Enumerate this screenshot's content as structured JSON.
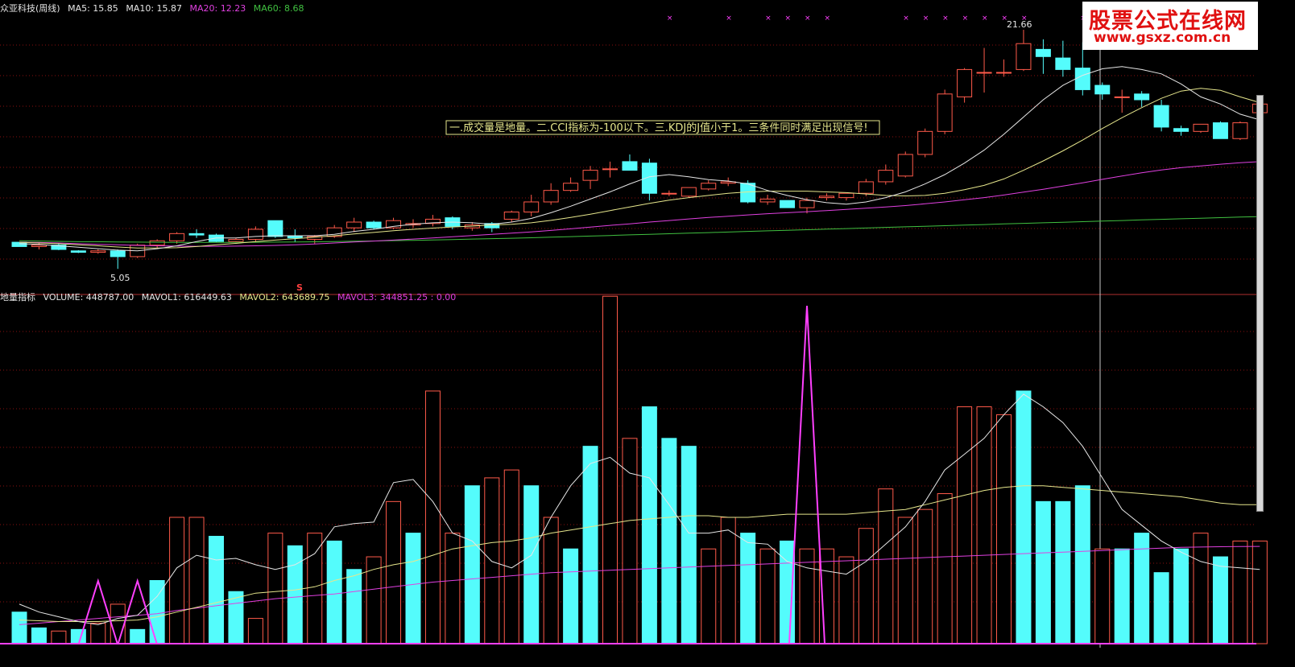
{
  "main_header": {
    "title": "众亚科技(周线)",
    "ma5": "MA5: 15.85",
    "ma10": "MA10: 15.87",
    "ma20": "MA20: 12.23",
    "ma60": "MA60: 8.68"
  },
  "volume_header": {
    "indicator_name": "地量指标",
    "volume": "VOLUME: 448787.00",
    "mavol1": "MAVOL1: 616449.63",
    "mavol2": "MAVOL2: 643689.75",
    "mavol3": "MAVOL3: 344851.25 : 0.00"
  },
  "annotation": "一.成交量是地量。二.CCI指标为-100以下。三.KDJ的J值小于1。三条件同时满足出现信号!",
  "high_label": "21.66",
  "low_label": "5.05",
  "signal_marker": "S",
  "watermark": {
    "title": "股票公式在线网",
    "url": "www.gsxz.com.cn"
  },
  "colors": {
    "up": "#ff5a4a",
    "down": "#54fcfc",
    "ma5": "#e6e6e6",
    "ma10": "#e6e68c",
    "ma20": "#e040e0",
    "ma60": "#40c040",
    "signal": "#ff40ff",
    "grid": "#8a1010"
  },
  "chart_data": [
    {
      "type": "candlestick",
      "title": "众亚科技(周线)",
      "ylim": [
        4.5,
        22.5
      ],
      "candles": [
        [
          6.9,
          6.9,
          6.6,
          6.6
        ],
        [
          6.6,
          6.85,
          6.4,
          6.7
        ],
        [
          6.7,
          6.8,
          6.35,
          6.4
        ],
        [
          6.3,
          6.35,
          6.15,
          6.2
        ],
        [
          6.2,
          6.4,
          6.1,
          6.3
        ],
        [
          6.3,
          6.4,
          5.05,
          5.9
        ],
        [
          5.9,
          6.8,
          5.8,
          6.7
        ],
        [
          6.7,
          7.1,
          6.5,
          7.0
        ],
        [
          7.0,
          7.6,
          6.8,
          7.5
        ],
        [
          7.5,
          7.8,
          7.2,
          7.4
        ],
        [
          7.4,
          7.5,
          6.9,
          6.95
        ],
        [
          6.95,
          7.2,
          6.9,
          7.1
        ],
        [
          7.1,
          8.0,
          6.9,
          7.8
        ],
        [
          8.4,
          8.4,
          7.2,
          7.3
        ],
        [
          7.3,
          7.8,
          6.9,
          7.2
        ],
        [
          7.1,
          7.4,
          6.8,
          7.3
        ],
        [
          7.3,
          8.1,
          7.2,
          7.9
        ],
        [
          7.9,
          8.6,
          7.6,
          8.3
        ],
        [
          8.3,
          8.4,
          7.8,
          7.9
        ],
        [
          7.9,
          8.6,
          7.8,
          8.4
        ],
        [
          8.1,
          8.5,
          7.9,
          8.2
        ],
        [
          8.2,
          8.8,
          8.0,
          8.5
        ],
        [
          8.6,
          8.7,
          7.8,
          8.0
        ],
        [
          7.9,
          8.3,
          7.7,
          8.1
        ],
        [
          8.2,
          8.3,
          7.6,
          7.9
        ],
        [
          8.5,
          9.1,
          8.3,
          9.0
        ],
        [
          9.0,
          10.2,
          8.7,
          9.7
        ],
        [
          9.7,
          11.0,
          9.5,
          10.5
        ],
        [
          10.5,
          11.4,
          10.4,
          11.0
        ],
        [
          11.2,
          12.2,
          10.6,
          11.9
        ],
        [
          12.0,
          12.5,
          11.4,
          12.0
        ],
        [
          12.5,
          13.0,
          11.9,
          11.9
        ],
        [
          12.4,
          12.7,
          9.8,
          10.3
        ],
        [
          10.3,
          10.5,
          10.1,
          10.3
        ],
        [
          10.1,
          10.7,
          10.0,
          10.7
        ],
        [
          10.6,
          11.2,
          10.5,
          11.0
        ],
        [
          11.0,
          11.4,
          10.8,
          11.1
        ],
        [
          11.0,
          11.2,
          9.6,
          9.7
        ],
        [
          9.7,
          10.2,
          9.5,
          9.9
        ],
        [
          9.8,
          9.8,
          9.3,
          9.3
        ],
        [
          9.3,
          10.0,
          8.9,
          9.8
        ],
        [
          10.0,
          10.3,
          9.8,
          10.1
        ],
        [
          10.0,
          10.3,
          9.8,
          10.3
        ],
        [
          10.3,
          11.3,
          10.1,
          11.1
        ],
        [
          11.1,
          12.3,
          10.9,
          11.9
        ],
        [
          11.5,
          13.2,
          11.4,
          13.0
        ],
        [
          13.0,
          14.8,
          12.8,
          14.6
        ],
        [
          14.6,
          17.5,
          14.4,
          17.2
        ],
        [
          17.0,
          19.0,
          16.6,
          18.9
        ],
        [
          18.7,
          20.4,
          17.3,
          18.7
        ],
        [
          18.7,
          19.6,
          18.4,
          18.7
        ],
        [
          18.9,
          21.66,
          18.8,
          20.7
        ],
        [
          20.3,
          21.0,
          18.6,
          19.8
        ],
        [
          19.7,
          20.9,
          18.4,
          18.9
        ],
        [
          19.0,
          20.8,
          17.1,
          17.5
        ],
        [
          17.8,
          18.0,
          16.8,
          17.2
        ],
        [
          17.0,
          17.5,
          15.9,
          17.0
        ],
        [
          17.2,
          17.4,
          16.3,
          16.8
        ],
        [
          16.4,
          16.8,
          14.6,
          14.9
        ],
        [
          14.8,
          15.0,
          14.3,
          14.6
        ],
        [
          14.6,
          15.1,
          14.5,
          15.1
        ],
        [
          15.2,
          15.3,
          14.1,
          14.1
        ],
        [
          14.1,
          15.3,
          14.0,
          15.2
        ],
        [
          15.9,
          17.0,
          15.9,
          16.5
        ]
      ],
      "ma5": [
        6.8,
        6.75,
        6.65,
        6.55,
        6.45,
        6.35,
        6.3,
        6.45,
        6.65,
        6.95,
        7.2,
        7.2,
        7.3,
        7.35,
        7.35,
        7.35,
        7.45,
        7.65,
        7.8,
        8.0,
        8.15,
        8.25,
        8.3,
        8.25,
        8.15,
        8.3,
        8.55,
        8.95,
        9.4,
        9.9,
        10.4,
        10.95,
        11.45,
        11.6,
        11.45,
        11.25,
        11.15,
        10.95,
        10.5,
        10.15,
        9.85,
        9.65,
        9.55,
        9.7,
        10.0,
        10.4,
        10.95,
        11.6,
        12.4,
        13.3,
        14.4,
        15.6,
        16.8,
        17.8,
        18.5,
        18.95,
        19.1,
        18.9,
        18.6,
        17.9,
        17.0,
        16.5,
        15.8,
        15.4
      ],
      "ma10": [
        6.9,
        6.85,
        6.8,
        6.72,
        6.65,
        6.57,
        6.5,
        6.5,
        6.52,
        6.6,
        6.72,
        6.82,
        6.95,
        7.05,
        7.15,
        7.25,
        7.35,
        7.48,
        7.58,
        7.7,
        7.8,
        7.88,
        7.96,
        8.02,
        8.1,
        8.15,
        8.25,
        8.42,
        8.62,
        8.85,
        9.1,
        9.35,
        9.6,
        9.82,
        10.0,
        10.15,
        10.3,
        10.4,
        10.45,
        10.45,
        10.45,
        10.4,
        10.35,
        10.25,
        10.15,
        10.12,
        10.15,
        10.3,
        10.55,
        10.85,
        11.3,
        11.9,
        12.55,
        13.25,
        14.0,
        14.8,
        15.55,
        16.25,
        16.9,
        17.4,
        17.6,
        17.45,
        17.0,
        16.6
      ],
      "ma20": [
        6.9,
        6.88,
        6.85,
        6.8,
        6.76,
        6.72,
        6.68,
        6.65,
        6.63,
        6.62,
        6.62,
        6.63,
        6.65,
        6.68,
        6.72,
        6.78,
        6.85,
        6.92,
        6.98,
        7.05,
        7.12,
        7.2,
        7.28,
        7.36,
        7.45,
        7.53,
        7.62,
        7.72,
        7.83,
        7.95,
        8.07,
        8.18,
        8.3,
        8.41,
        8.52,
        8.62,
        8.71,
        8.8,
        8.88,
        8.95,
        9.02,
        9.1,
        9.18,
        9.26,
        9.35,
        9.45,
        9.57,
        9.7,
        9.85,
        10.0,
        10.18,
        10.38,
        10.58,
        10.8,
        11.03,
        11.27,
        11.5,
        11.72,
        11.92,
        12.08,
        12.2,
        12.32,
        12.42,
        12.5
      ],
      "ma60": [
        7.0,
        6.98,
        6.96,
        6.94,
        6.93,
        6.92,
        6.91,
        6.9,
        6.89,
        6.89,
        6.89,
        6.89,
        6.9,
        6.91,
        6.92,
        6.93,
        6.95,
        6.97,
        6.99,
        7.01,
        7.03,
        7.06,
        7.09,
        7.12,
        7.15,
        7.18,
        7.21,
        7.25,
        7.29,
        7.33,
        7.37,
        7.41,
        7.45,
        7.49,
        7.53,
        7.57,
        7.61,
        7.65,
        7.69,
        7.73,
        7.77,
        7.81,
        7.85,
        7.89,
        7.93,
        7.97,
        8.01,
        8.05,
        8.09,
        8.13,
        8.17,
        8.21,
        8.25,
        8.29,
        8.33,
        8.37,
        8.41,
        8.45,
        8.49,
        8.53,
        8.57,
        8.61,
        8.65,
        8.68
      ]
    },
    {
      "type": "bar",
      "title": "地量指标",
      "series_names": [
        "VOLUME",
        "MAVOL1",
        "MAVOL2",
        "MAVOL3"
      ],
      "ylim": [
        0,
        2150000
      ],
      "volume": [
        200000,
        100000,
        80000,
        90000,
        130000,
        250000,
        90000,
        400000,
        800000,
        800000,
        680000,
        330000,
        160000,
        700000,
        620000,
        700000,
        650000,
        470000,
        550000,
        900000,
        700000,
        1600000,
        700000,
        1000000,
        1050000,
        1100000,
        1000000,
        800000,
        600000,
        1250000,
        2200000,
        1300000,
        1500000,
        1300000,
        1250000,
        600000,
        800000,
        700000,
        600000,
        650000,
        600000,
        600000,
        550000,
        730000,
        980000,
        800000,
        850000,
        950000,
        1500000,
        1500000,
        1450000,
        1600000,
        900000,
        900000,
        1000000,
        600000,
        600000,
        700000,
        450000,
        600000,
        700000,
        550000,
        650000,
        650000
      ],
      "volume_direction": [
        -1,
        -1,
        1,
        -1,
        1,
        1,
        -1,
        -1,
        1,
        1,
        -1,
        -1,
        1,
        1,
        -1,
        1,
        -1,
        -1,
        1,
        1,
        -1,
        1,
        1,
        -1,
        1,
        1,
        -1,
        1,
        -1,
        -1,
        1,
        1,
        -1,
        -1,
        -1,
        1,
        1,
        -1,
        1,
        -1,
        1,
        1,
        1,
        1,
        1,
        1,
        1,
        1,
        1,
        1,
        1,
        -1,
        -1,
        -1,
        -1,
        1,
        -1,
        -1,
        -1,
        -1,
        1,
        -1,
        1,
        1
      ],
      "mavol1": [
        250000,
        200000,
        170000,
        140000,
        120000,
        160000,
        180000,
        300000,
        480000,
        560000,
        530000,
        540000,
        500000,
        470000,
        500000,
        570000,
        740000,
        760000,
        770000,
        1020000,
        1040000,
        900000,
        700000,
        650000,
        520000,
        480000,
        560000,
        800000,
        1000000,
        1140000,
        1180000,
        1080000,
        1050000,
        880000,
        700000,
        700000,
        720000,
        640000,
        630000,
        520000,
        480000,
        460000,
        440000,
        520000,
        630000,
        740000,
        900000,
        1100000,
        1200000,
        1300000,
        1450000,
        1580000,
        1500000,
        1400000,
        1250000,
        1050000,
        850000,
        750000,
        650000,
        580000,
        520000,
        490000,
        480000,
        470000
      ],
      "mavol2": [
        150000,
        145000,
        140000,
        140000,
        140000,
        145000,
        150000,
        170000,
        200000,
        230000,
        260000,
        290000,
        320000,
        330000,
        340000,
        360000,
        400000,
        430000,
        470000,
        500000,
        520000,
        560000,
        600000,
        620000,
        640000,
        650000,
        670000,
        700000,
        720000,
        740000,
        760000,
        780000,
        790000,
        800000,
        810000,
        810000,
        800000,
        800000,
        810000,
        820000,
        820000,
        820000,
        820000,
        830000,
        840000,
        850000,
        880000,
        910000,
        940000,
        970000,
        990000,
        1000000,
        1000000,
        990000,
        980000,
        970000,
        960000,
        950000,
        940000,
        930000,
        910000,
        890000,
        880000,
        880000
      ],
      "mavol3": [
        0,
        0,
        0,
        0,
        0,
        0,
        0,
        0,
        0,
        0,
        0,
        0,
        0,
        0,
        0,
        0,
        0,
        0,
        0,
        0,
        0,
        0,
        0,
        0,
        0,
        0,
        0,
        0,
        0,
        0,
        0,
        0,
        0,
        0,
        0,
        0,
        0,
        0,
        0,
        0,
        0,
        0,
        0,
        0,
        0,
        0,
        0,
        0,
        0,
        0,
        0,
        0,
        0,
        0,
        0,
        0,
        0,
        0,
        0,
        0,
        0,
        0,
        0,
        0
      ],
      "mavol3_line": [
        120000,
        130000,
        140000,
        150000,
        160000,
        170000,
        180000,
        190000,
        210000,
        225000,
        240000,
        255000,
        270000,
        285000,
        295000,
        305000,
        315000,
        330000,
        345000,
        360000,
        375000,
        390000,
        400000,
        410000,
        420000,
        430000,
        440000,
        450000,
        455000,
        460000,
        465000,
        470000,
        475000,
        480000,
        485000,
        490000,
        495000,
        500000,
        505000,
        510000,
        515000,
        520000,
        525000,
        530000,
        535000,
        540000,
        545000,
        550000,
        555000,
        560000,
        565000,
        570000,
        575000,
        580000,
        585000,
        590000,
        595000,
        600000,
        605000,
        610000,
        612000,
        614000,
        615000,
        616000
      ],
      "signal_flags": [
        0,
        0,
        0,
        0,
        1,
        0,
        1,
        0,
        0,
        0,
        0,
        0,
        0,
        0,
        0,
        0,
        0,
        0,
        0,
        0,
        0,
        0,
        0,
        0,
        0,
        0,
        0,
        0,
        0,
        0,
        0,
        0,
        0,
        0,
        0,
        0,
        0,
        0,
        0,
        0,
        1,
        0,
        0,
        0,
        0,
        0,
        0,
        0,
        0,
        0,
        0,
        0,
        0,
        0,
        0,
        0,
        0,
        0,
        0,
        0,
        0,
        0,
        0,
        0
      ]
    }
  ]
}
